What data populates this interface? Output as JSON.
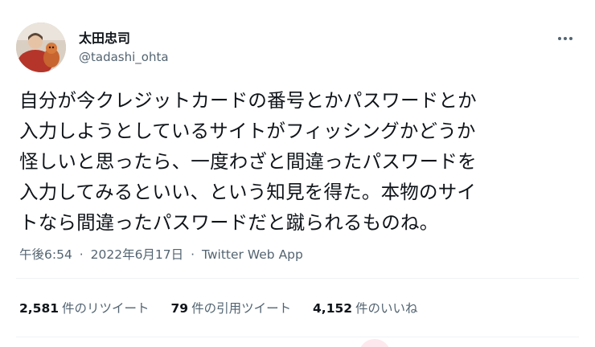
{
  "author": {
    "display_name": "太田忠司",
    "handle": "@tadashi_ohta"
  },
  "tweet": {
    "lines": [
      "自分が今クレジットカードの番号とかパスワードとか",
      "入力しようとしているサイトがフィッシングかどうか",
      "怪しいと思ったら、一度わざと間違ったパスワードを",
      "入力してみるといい、という知見を得た。本物のサイ",
      "トなら間違ったパスワードだと蹴られるものね。"
    ]
  },
  "meta": {
    "time": "午後6:54",
    "separator": "·",
    "date": "2022年6月17日",
    "source": "Twitter Web App"
  },
  "stats": [
    {
      "count": "2,581",
      "label": "件のリツイート"
    },
    {
      "count": "79",
      "label": "件の引用ツイート"
    },
    {
      "count": "4,152",
      "label": "件のいいね"
    }
  ],
  "icons": {
    "more": "more-horizontal-icon",
    "like": "heart-icon"
  },
  "colors": {
    "text": "#0f1419",
    "secondary": "#536471",
    "like_accent": "#f91880"
  }
}
